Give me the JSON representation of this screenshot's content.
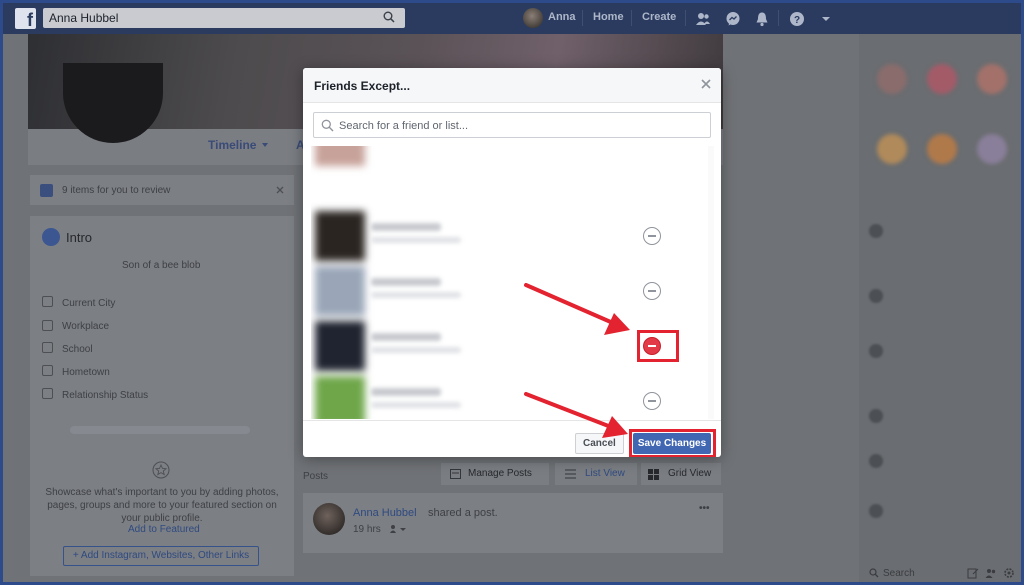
{
  "topbar": {
    "logo": "f",
    "search_value": "Anna Hubbel",
    "user_name": "Anna",
    "home_label": "Home",
    "create_label": "Create",
    "icons": [
      "friend-requests-icon",
      "messenger-icon",
      "notifications-icon",
      "help-icon",
      "account-menu-icon"
    ]
  },
  "profile": {
    "timeline_label": "Timeline",
    "about_label_partial": "A",
    "review_text": "9 items for you to review",
    "intro_title": "Intro",
    "bio": "Son of a bee blob",
    "intro_rows": [
      "Current City",
      "Workplace",
      "School",
      "Hometown",
      "Relationship Status"
    ],
    "featured_text": "Showcase what's important to you by adding photos, pages, groups and more to your featured section on your public profile.",
    "add_featured_label": "Add to Featured",
    "add_links_label": "+ Add Instagram, Websites, Other Links"
  },
  "posts": {
    "posts_label": "Posts",
    "manage_posts_label": "Manage Posts",
    "list_view_label": "List View",
    "grid_view_label": "Grid View",
    "post_author": "Anna Hubbel",
    "post_action": "shared a post.",
    "post_time": "19 hrs",
    "more_label": "•••"
  },
  "chat": {
    "search_placeholder": "Search"
  },
  "modal": {
    "title": "Friends Except...",
    "search_placeholder": "Search for a friend or list...",
    "cancel_label": "Cancel",
    "save_label": "Save Changes",
    "friends": [
      {
        "photo_color": "#c7a29a",
        "removed": false
      },
      {
        "photo_color": "#2b2522",
        "removed": false
      },
      {
        "photo_color": "#9aa6b8",
        "removed": false
      },
      {
        "photo_color": "#1f2430",
        "removed": true
      },
      {
        "photo_color": "#6fa64a",
        "removed": false
      }
    ]
  },
  "colors": {
    "accent": "#4267b2",
    "annotation_red": "#e3232f",
    "remove_active": "#e23a47"
  }
}
